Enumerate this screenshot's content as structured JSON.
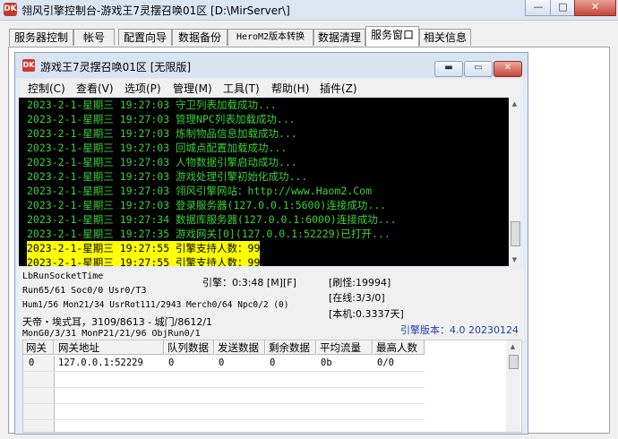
{
  "window": {
    "app_icon": "DK",
    "title": "翎风引擎控制台-游戏王7灵摆召唤01区 [D:\\MirServer\\]",
    "minimize_glyph": "—",
    "maximize_glyph": "□",
    "close_glyph": "✕"
  },
  "tabs": [
    {
      "label": "服务器控制"
    },
    {
      "label": "帐号"
    },
    {
      "label": "配置向导"
    },
    {
      "label": "数据备份"
    },
    {
      "label": "HeroM2版本转换"
    },
    {
      "label": "数据清理"
    },
    {
      "label": "服务窗口"
    },
    {
      "label": "相关信息"
    }
  ],
  "active_tab": "服务窗口",
  "inner_window": {
    "icon": "DK",
    "title": "游戏王7灵摆召唤01区 [无限版]",
    "minimize_glyph": "▬",
    "maximize_glyph": "▭",
    "close_glyph": "✕"
  },
  "menu": [
    "控制(C)",
    "查看(V)",
    "选项(P)",
    "管理(M)",
    "工具(T)",
    "帮助(H)",
    "插件(Z)"
  ],
  "log": [
    {
      "text": "2023-2-1-星期三  19:27:03  守卫列表加载成功...",
      "hl": false
    },
    {
      "text": "2023-2-1-星期三  19:27:03  管理NPC列表加载成功...",
      "hl": false
    },
    {
      "text": "2023-2-1-星期三  19:27:03  炼制物品信息加载成功...",
      "hl": false
    },
    {
      "text": "2023-2-1-星期三  19:27:03  回城点配置加载成功...",
      "hl": false
    },
    {
      "text": "2023-2-1-星期三  19:27:03  人物数据引擎启动成功...",
      "hl": false
    },
    {
      "text": "2023-2-1-星期三  19:27:03  游戏处理引擎初始化成功...",
      "hl": false
    },
    {
      "text": "2023-2-1-星期三  19:27:03  翎风引擎网站：http://www.Haom2.Com",
      "hl": false
    },
    {
      "text": "2023-2-1-星期三  19:27:03  登录服务器(127.0.0.1:5600)连接成功...",
      "hl": false
    },
    {
      "text": "2023-2-1-星期三  19:27:34  数据库服务器(127.0.0.1:6000)连接成功...",
      "hl": false
    },
    {
      "text": "2023-2-1-星期三  19:27:35  游戏网关[0](127.0.0.1:52229)已打开...",
      "hl": false
    },
    {
      "text": "2023-2-1-星期三  19:27:55  引擎支持人数：99",
      "hl": true
    },
    {
      "text": "2023-2-1-星期三  19:27:55  引擎支持人数：99",
      "hl": true
    }
  ],
  "status": {
    "run_socket_time": "LbRunSocketTime",
    "engine_time": "引擎：0:3:48 [M][F]",
    "refresh_monster": "[刷怪:19994]",
    "online": "[在线:3/3/0]",
    "local": "[本机:0.3337天]",
    "run_line": "Run65/61 Soc0/0 Usr0/T3",
    "hum_line": "Hum1/56 Mon21/34 UsrRot111/2943 Merch0/64 Npc0/2 (0)",
    "location_line": "天帝・埃式耳，3109/8613 - 城门/8612/1",
    "mon_line": "MonG0/3/31 MonP21/21/96 ObjRun0/1",
    "engine_version": "引擎版本：4.0 20230124"
  },
  "gateway_table": {
    "columns": [
      "网关",
      "网关地址",
      "队列数据",
      "发送数据",
      "剩余数据",
      "平均流量",
      "最高人数"
    ],
    "rows": [
      [
        "0",
        "127.0.0.1:52229",
        "0",
        "0",
        "0",
        "0b",
        "0/0"
      ]
    ]
  }
}
